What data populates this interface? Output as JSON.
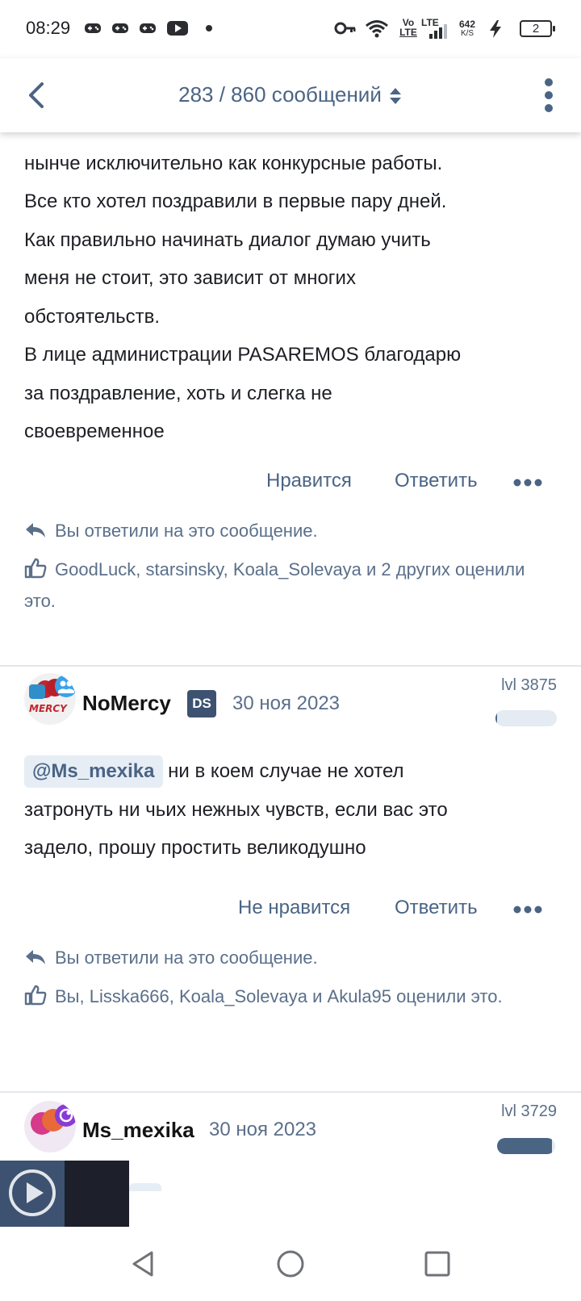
{
  "status_bar": {
    "time": "08:29",
    "volte_top": "Vo",
    "volte_bottom": "LTE",
    "lte": "LTE",
    "speed_value": "642",
    "speed_unit": "K/S",
    "battery": "2",
    "icons": [
      "gamepad-icon",
      "gamepad-icon",
      "gamepad-icon",
      "youtube-icon",
      "dot-icon",
      "key-icon",
      "wifi-icon",
      "signal-icon",
      "charging-icon"
    ]
  },
  "header": {
    "title": "283 / 860 сообщений",
    "icons": [
      "back-arrow-icon",
      "sort-icon",
      "kebab-menu-icon"
    ]
  },
  "posts": [
    {
      "body_lines": [
        "нынче исключительно как конкурсные работы.",
        "Все кто хотел поздравили в первые пару дней.",
        "Как правильно начинать диалог думаю учить",
        "меня не стоит, это зависит от многих",
        "обстоятельств.",
        "В лице администрации PASAREMOS благодарю",
        "за поздравление, хоть и слегка не",
        "своевременное"
      ],
      "like_label": "Нравится",
      "reply_label": "Ответить",
      "replied_note": "Вы ответили на это сообщение.",
      "reactions": "GoodLuck, starsinsky, Koala_Solevaya и 2 других оценили это."
    },
    {
      "username": "NoMercy",
      "badge": "DS",
      "date": "30 ноя 2023",
      "level": "lvl 3875",
      "level_progress": 0.02,
      "mention": "@Ms_mexika",
      "body_first": "ни в коем случае не хотел",
      "body_lines": [
        "затронуть ни чьих нежных чувств, если вас это",
        "задело, прошу простить великодушно"
      ],
      "like_label": "Не нравится",
      "reply_label": "Ответить",
      "replied_note": "Вы ответили на это сообщение.",
      "reactions": "Вы, Lisska666, Koala_Solevaya и Akula95 оценили это."
    },
    {
      "username": "Ms_mexika",
      "date": "30 ноя 2023",
      "level": "lvl 3729",
      "level_progress": 0.95
    }
  ],
  "colors": {
    "accent": "#4a6484",
    "meta_text": "#5b6f8a",
    "badge_bg": "#3c5270",
    "mention_bg": "#e6edf5",
    "divider": "#e3e7ec"
  },
  "nav_bar": {
    "icons": [
      "back-triangle-icon",
      "home-circle-icon",
      "recents-square-icon"
    ]
  },
  "mini_player": {
    "icons": [
      "play-icon"
    ]
  }
}
